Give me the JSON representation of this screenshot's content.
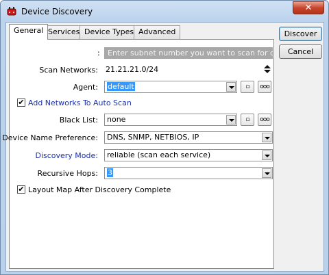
{
  "window": {
    "title": "Device Discovery",
    "close_glyph": "✕"
  },
  "tabs": [
    {
      "label": "General",
      "active": true
    },
    {
      "label": "Services",
      "active": false
    },
    {
      "label": "Device Types",
      "active": false
    },
    {
      "label": "Advanced",
      "active": false
    }
  ],
  "general": {
    "subnet_hint_label": ":",
    "subnet_hint_text": "Enter subnet number you want to scan for devices",
    "scan_networks": {
      "label": "Scan Networks:",
      "value": "21.21.21.0/24"
    },
    "agent": {
      "label": "Agent:",
      "value": "default"
    },
    "add_networks": {
      "label": "Add Networks To Auto Scan",
      "checked": true
    },
    "black_list": {
      "label": "Black List:",
      "value": "none"
    },
    "device_name_pref": {
      "label": "Device Name Preference:",
      "value": "DNS, SNMP, NETBIOS, IP"
    },
    "discovery_mode": {
      "label": "Discovery Mode:",
      "value": "reliable (scan each service)"
    },
    "recursive_hops": {
      "label": "Recursive Hops:",
      "value": "3"
    },
    "layout_map": {
      "label": "Layout Map After Discovery Complete",
      "checked": true
    },
    "small_button_label": "▫",
    "ellipsis_button_label": "ooo"
  },
  "actions": {
    "discover": "Discover",
    "cancel": "Cancel"
  },
  "colors": {
    "link_blue": "#1a2fa8",
    "selection": "#3399ff",
    "hint_bg": "#a8a8a8"
  },
  "icons": {
    "app": "router-icon",
    "check": "✔"
  }
}
